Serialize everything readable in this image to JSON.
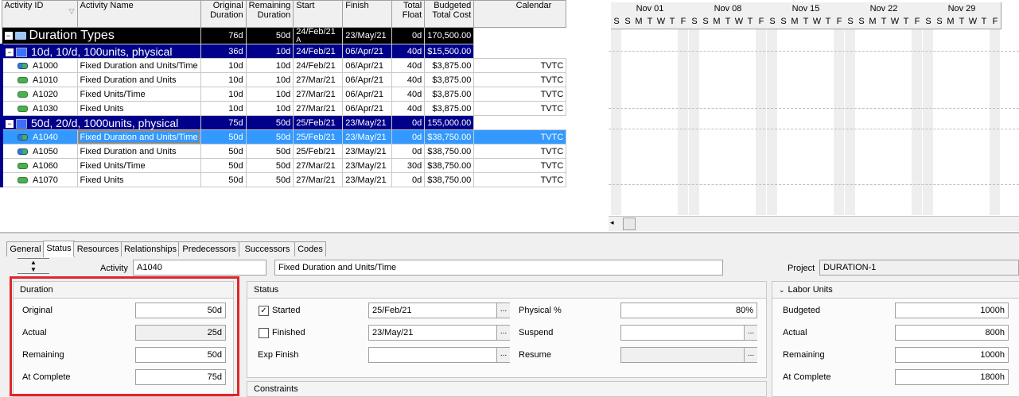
{
  "columns": [
    "Activity ID",
    "Activity Name",
    "Original Duration",
    "Remaining Duration",
    "Start",
    "Finish",
    "Total Float",
    "Budgeted Total Cost",
    "Calendar"
  ],
  "column_heads": {
    "id": "Activity ID",
    "name": "Activity Name",
    "orig1": "Original",
    "orig2": "Duration",
    "rem1": "Remaining",
    "rem2": "Duration",
    "start": "Start",
    "finish": "Finish",
    "tf1": "Total",
    "tf2": "Float",
    "btc1": "Budgeted",
    "btc2": "Total Cost",
    "cal": "Calendar"
  },
  "wbs_root": {
    "name": "Duration Types",
    "orig": "76d",
    "rem": "50d",
    "start": "24/Feb/21",
    "start_flag": "A",
    "finish": "23/May/21",
    "float": "0d",
    "cost": "170,500.00"
  },
  "wbs_a": {
    "name": "10d, 10/d, 100units, physical",
    "orig": "36d",
    "rem": "10d",
    "start": "24/Feb/21",
    "finish": "06/Apr/21",
    "float": "40d",
    "cost": "$15,500.00"
  },
  "wbs_b": {
    "name": "50d, 20/d, 1000units, physical",
    "orig": "75d",
    "rem": "50d",
    "start": "25/Feb/21",
    "finish": "23/May/21",
    "float": "0d",
    "cost": "155,000.00"
  },
  "activities": [
    {
      "id": "A1000",
      "name": "Fixed Duration and Units/Time",
      "orig": "10d",
      "rem": "10d",
      "start": "24/Feb/21",
      "finish": "06/Apr/21",
      "float": "40d",
      "cost": "$3,875.00",
      "cal": "TVTC"
    },
    {
      "id": "A1010",
      "name": "Fixed Duration and Units",
      "orig": "10d",
      "rem": "10d",
      "start": "27/Mar/21",
      "finish": "06/Apr/21",
      "float": "40d",
      "cost": "$3,875.00",
      "cal": "TVTC"
    },
    {
      "id": "A1020",
      "name": "Fixed Units/Time",
      "orig": "10d",
      "rem": "10d",
      "start": "27/Mar/21",
      "finish": "06/Apr/21",
      "float": "40d",
      "cost": "$3,875.00",
      "cal": "TVTC"
    },
    {
      "id": "A1030",
      "name": "Fixed Units",
      "orig": "10d",
      "rem": "10d",
      "start": "27/Mar/21",
      "finish": "06/Apr/21",
      "float": "40d",
      "cost": "$3,875.00",
      "cal": "TVTC"
    },
    {
      "id": "A1040",
      "name": "Fixed Duration and Units/Time",
      "orig": "50d",
      "rem": "50d",
      "start": "25/Feb/21",
      "finish": "23/May/21",
      "float": "0d",
      "cost": "$38,750.00",
      "cal": "TVTC"
    },
    {
      "id": "A1050",
      "name": "Fixed Duration and Units",
      "orig": "50d",
      "rem": "50d",
      "start": "25/Feb/21",
      "finish": "23/May/21",
      "float": "0d",
      "cost": "$38,750.00",
      "cal": "TVTC"
    },
    {
      "id": "A1060",
      "name": "Fixed Units/Time",
      "orig": "50d",
      "rem": "50d",
      "start": "27/Mar/21",
      "finish": "23/May/21",
      "float": "30d",
      "cost": "$38,750.00",
      "cal": "TVTC"
    },
    {
      "id": "A1070",
      "name": "Fixed Units",
      "orig": "50d",
      "rem": "50d",
      "start": "27/Mar/21",
      "finish": "23/May/21",
      "float": "0d",
      "cost": "$38,750.00",
      "cal": "TVTC"
    }
  ],
  "gantt": {
    "weeks": [
      "Nov 01",
      "Nov 08",
      "Nov 15",
      "Nov 22",
      "Nov 29"
    ],
    "days": [
      "S",
      "S",
      "M",
      "T",
      "W",
      "T",
      "F"
    ]
  },
  "tabs": [
    "General",
    "Status",
    "Resources",
    "Relationships",
    "Predecessors",
    "Successors",
    "Codes"
  ],
  "active_tab": "Status",
  "detail": {
    "activity_label": "Activity",
    "activity_id": "A1040",
    "activity_name": "Fixed Duration and Units/Time",
    "project_label": "Project",
    "project_id": "DURATION-1"
  },
  "duration": {
    "title": "Duration",
    "original_label": "Original",
    "original": "50d",
    "actual_label": "Actual",
    "actual": "25d",
    "remaining_label": "Remaining",
    "remaining": "50d",
    "at_complete_label": "At Complete",
    "at_complete": "75d"
  },
  "status": {
    "title": "Status",
    "started_label": "Started",
    "started": true,
    "started_date": "25/Feb/21",
    "finished_label": "Finished",
    "finished": false,
    "finished_date": "23/May/21",
    "exp_finish_label": "Exp Finish",
    "exp_finish": "",
    "physical_label": "Physical %",
    "physical": "80%",
    "suspend_label": "Suspend",
    "suspend": "",
    "resume_label": "Resume",
    "resume": ""
  },
  "constraints_title": "Constraints",
  "labor": {
    "title": "Labor Units",
    "budgeted_label": "Budgeted",
    "budgeted": "1000h",
    "actual_label": "Actual",
    "actual": "800h",
    "remaining_label": "Remaining",
    "remaining": "1000h",
    "at_complete_label": "At Complete",
    "at_complete": "1800h"
  },
  "colors": {
    "wbs_root_bg": "#000000",
    "wbs_bg": "#00008b",
    "selection": "#3399ff",
    "highlight_box": "#e0252c"
  }
}
